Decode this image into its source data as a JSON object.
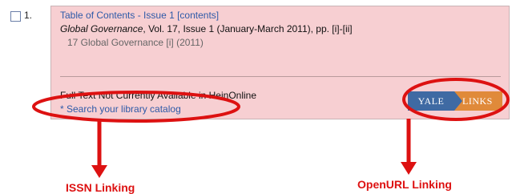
{
  "result": {
    "number": "1.",
    "title": "Table of Contents - Issue 1 [contents]",
    "citation_journal": "Global Governance",
    "citation_rest": ", Vol. 17, Issue 1 (January-March 2011), pp. [i]-[ii]",
    "citation_short": "17 Global Governance [i] (2011)",
    "fulltext_note": "Full Text Not Currently Available in HeinOnline",
    "catalog_link": "* Search your library catalog",
    "yale_links": {
      "left": "YALE",
      "right": "LINKS"
    }
  },
  "annotations": {
    "issn_label": "ISSN Linking",
    "openurl_label": "OpenURL Linking",
    "color": "#dd1111"
  },
  "colors": {
    "card_bg": "#f7cfd2",
    "link": "#2e5aa8",
    "yale_blue": "#3f6aa3",
    "yale_orange": "#e08a3a"
  }
}
